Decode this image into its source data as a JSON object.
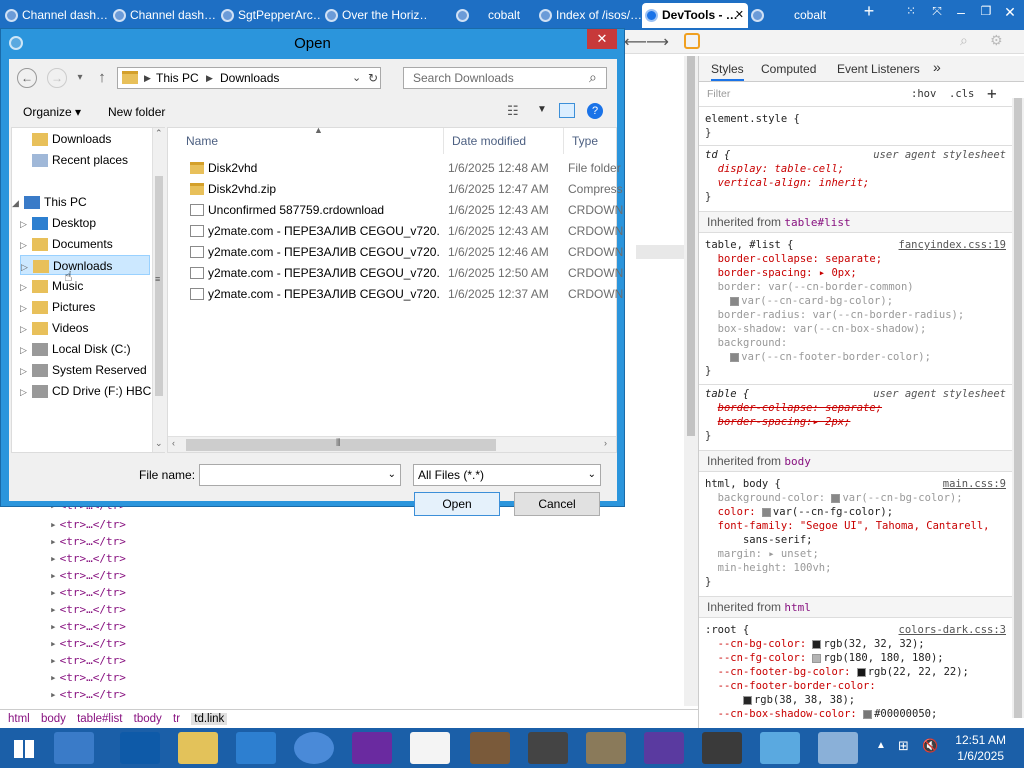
{
  "tabs": [
    {
      "label": "Channel dash…",
      "active": false
    },
    {
      "label": "Channel dash…",
      "active": false
    },
    {
      "label": "SgtPepperArc…",
      "active": false
    },
    {
      "label": "Over the Horiz…",
      "active": false
    },
    {
      "label": "cobalt",
      "active": false
    },
    {
      "label": "Index of /isos/…",
      "active": false
    },
    {
      "label": "DevTools - …",
      "active": true
    },
    {
      "label": "cobalt",
      "active": false
    }
  ],
  "devtools": {
    "tabs": [
      "Styles",
      "Computed",
      "Event Listeners"
    ],
    "filter_placeholder": "Filter",
    "hov": ":hov",
    "cls": ".cls",
    "element_style": "element.style {",
    "close_brace": "}",
    "td_selector": "td {",
    "ua_label": "user agent stylesheet",
    "td_display": "display: table-cell;",
    "td_valign": "vertical-align: inherit;",
    "inherited_table_label": "Inherited from",
    "inherited_table_target": "table#list",
    "tablelist_selector": "table, #list {",
    "tablelist_src": "fancyindex.css:19",
    "tl_1": "border-collapse: separate;",
    "tl_2": "border-spacing: ▸ 0px;",
    "tl_3": "border: var(--cn-border-common)",
    "tl_4": "var(--cn-card-bg-color);",
    "tl_5": "border-radius: var(--cn-border-radius);",
    "tl_6": "box-shadow: var(--cn-box-shadow);",
    "tl_7": "background:",
    "tl_8": "var(--cn-footer-border-color);",
    "table_selector": "table {",
    "tb_1": "border-collapse: separate;",
    "tb_2": "border-spacing:▸ 2px;",
    "inherited_body_label": "Inherited from",
    "inherited_body_target": "body",
    "hb_selector": "html, body {",
    "hb_src": "main.css:9",
    "hb_1": "background-color: ",
    "hb_1v": "var(--cn-bg-color);",
    "hb_2": "color: ",
    "hb_2v": "var(--cn-fg-color);",
    "hb_3": "font-family: \"Segoe UI\", Tahoma, Cantarell,",
    "hb_4": "sans-serif;",
    "hb_5": "margin: ▸ unset;",
    "hb_6": "min-height: 100vh;",
    "inherited_html_label": "Inherited from",
    "inherited_html_target": "html",
    "root_selector": ":root {",
    "root_src": "colors-dark.css:3",
    "r_1": "--cn-bg-color: ",
    "r_1v": "rgb(32, 32, 32);",
    "r_2": "--cn-fg-color: ",
    "r_2v": "rgb(180, 180, 180);",
    "r_3": "--cn-footer-bg-color: ",
    "r_3v": "rgb(22, 22, 22);",
    "r_4": "--cn-footer-border-color:",
    "r_4v": "rgb(38, 38, 38);",
    "r_5": "--cn-box-shadow-color: ",
    "r_5v": "#00000050;"
  },
  "elements": {
    "tr_text": "<tr>…</tr>",
    "crumbs": [
      "html",
      "body",
      "table#list",
      "tbody",
      "tr",
      "td.link"
    ]
  },
  "dialog": {
    "title": "Open",
    "close": "✕",
    "breadcrumb": [
      "This PC",
      "Downloads"
    ],
    "search_placeholder": "Search Downloads",
    "organize": "Organize ▾",
    "new_folder": "New folder",
    "tree": [
      {
        "label": "Downloads",
        "indent": 1
      },
      {
        "label": "Recent places",
        "indent": 1
      },
      {
        "label": "This PC",
        "indent": 0
      },
      {
        "label": "Desktop",
        "indent": 1
      },
      {
        "label": "Documents",
        "indent": 1
      },
      {
        "label": "Downloads",
        "indent": 1
      },
      {
        "label": "Music",
        "indent": 1
      },
      {
        "label": "Pictures",
        "indent": 1
      },
      {
        "label": "Videos",
        "indent": 1
      },
      {
        "label": "Local Disk (C:)",
        "indent": 1
      },
      {
        "label": "System Reserved",
        "indent": 1
      },
      {
        "label": "CD Drive (F:) HBC",
        "indent": 1
      }
    ],
    "columns": [
      "Name",
      "Date modified",
      "Type"
    ],
    "files": [
      {
        "name": "Disk2vhd",
        "date": "1/6/2025 12:48 AM",
        "type": "File folder",
        "kind": "folder"
      },
      {
        "name": "Disk2vhd.zip",
        "date": "1/6/2025 12:47 AM",
        "type": "Compress",
        "kind": "folder"
      },
      {
        "name": "Unconfirmed 587759.crdownload",
        "date": "1/6/2025 12:43 AM",
        "type": "CRDOWN",
        "kind": "doc"
      },
      {
        "name": "y2mate.com - ПЕРЕЗАЛИВ CEGOU_v720...",
        "date": "1/6/2025 12:43 AM",
        "type": "CRDOWN",
        "kind": "doc"
      },
      {
        "name": "y2mate.com - ПЕРЕЗАЛИВ CEGOU_v720...",
        "date": "1/6/2025 12:46 AM",
        "type": "CRDOWN",
        "kind": "doc"
      },
      {
        "name": "y2mate.com - ПЕРЕЗАЛИВ CEGOU_v720...",
        "date": "1/6/2025 12:50 AM",
        "type": "CRDOWN",
        "kind": "doc"
      },
      {
        "name": "y2mate.com - ПЕРЕЗАЛИВ CEGOU_v720...",
        "date": "1/6/2025 12:37 AM",
        "type": "CRDOWN",
        "kind": "doc"
      }
    ],
    "filename_label": "File name:",
    "filename_value": "",
    "filter_value": "All Files (*.*)",
    "open": "Open",
    "cancel": "Cancel"
  },
  "taskbar": {
    "time": "12:51 AM",
    "date": "1/6/2025"
  },
  "colors": {
    "tabbar": "#1e6fc4",
    "dialog_frame": "#2b95dc",
    "taskbar": "#1b5fa8",
    "close_red": "#c7393a"
  }
}
